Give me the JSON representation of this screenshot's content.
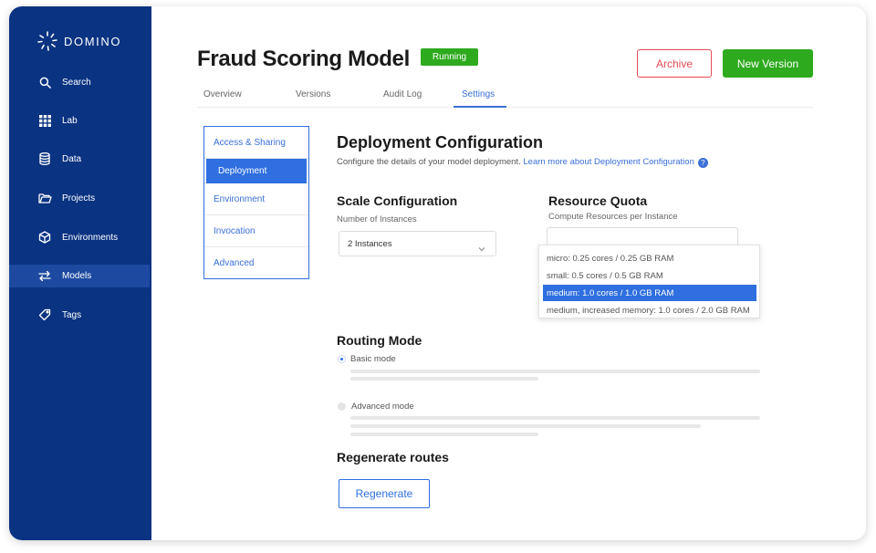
{
  "app": {
    "brand": "DOMINO"
  },
  "sidebar": {
    "items": [
      {
        "label": "Search",
        "icon": "search-icon"
      },
      {
        "label": "Lab",
        "icon": "grid-icon"
      },
      {
        "label": "Data",
        "icon": "database-icon"
      },
      {
        "label": "Projects",
        "icon": "folder-icon"
      },
      {
        "label": "Environments",
        "icon": "cube-icon"
      },
      {
        "label": "Models",
        "icon": "arrows-icon",
        "active": true
      },
      {
        "label": "Tags",
        "icon": "tag-icon"
      }
    ]
  },
  "header": {
    "title": "Fraud Scoring Model",
    "status": "Running",
    "archive_label": "Archive",
    "new_version_label": "New Version"
  },
  "tabs": [
    {
      "label": "Overview"
    },
    {
      "label": "Versions"
    },
    {
      "label": "Audit Log"
    },
    {
      "label": "Settings",
      "active": true
    }
  ],
  "settings_nav": [
    {
      "label": "Access & Sharing"
    },
    {
      "label": "Deployment",
      "active": true
    },
    {
      "label": "Environment"
    },
    {
      "label": "Invocation"
    },
    {
      "label": "Advanced"
    }
  ],
  "deployment": {
    "title": "Deployment Configuration",
    "description": "Configure the details of your model deployment.",
    "learn_more": "Learn more about Deployment Configuration",
    "scale": {
      "title": "Scale Configuration",
      "label": "Number of Instances",
      "value": "2 Instances"
    },
    "quota": {
      "title": "Resource Quota",
      "label": "Compute Resources per Instance",
      "options": [
        "micro: 0.25 cores / 0.25 GB RAM",
        "small: 0.5 cores / 0.5 GB RAM",
        "medium: 1.0 cores / 1.0 GB RAM",
        "medium, increased memory: 1.0 cores / 2.0 GB RAM"
      ],
      "selected_index": 2
    },
    "routing": {
      "title": "Routing Mode",
      "basic": "Basic mode",
      "advanced": "Advanced mode",
      "selected": "Basic mode"
    },
    "regenerate": {
      "title": "Regenerate routes",
      "button": "Regenerate"
    }
  },
  "colors": {
    "sidebar": "#0a3382",
    "accent": "#2f6fe0",
    "success": "#2eaa1e",
    "danger": "#e44b54"
  }
}
